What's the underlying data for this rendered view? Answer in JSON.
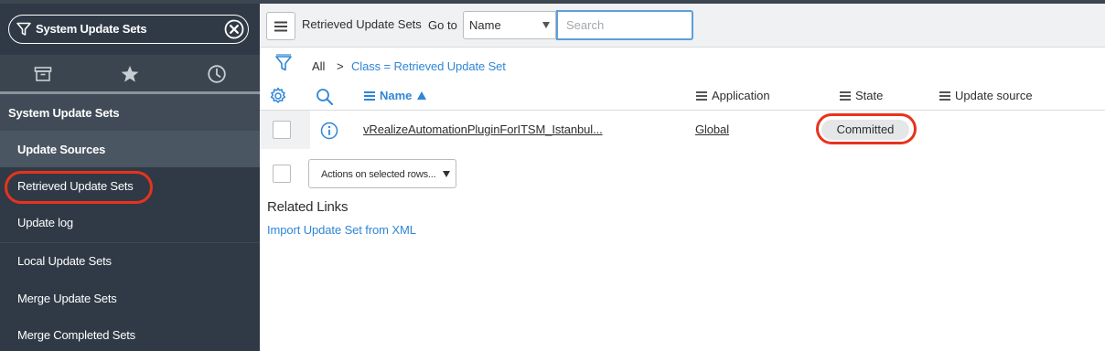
{
  "nav": {
    "filter_text": "System Update Sets",
    "tabs": [
      {
        "icon": "archive-icon"
      },
      {
        "icon": "star-icon"
      },
      {
        "icon": "clock-icon"
      }
    ],
    "section_label": "System Update Sets",
    "items": [
      {
        "label": "Update Sources"
      },
      {
        "label": "Retrieved Update Sets"
      },
      {
        "label": "Update log"
      },
      {
        "label": "Local Update Sets"
      },
      {
        "label": "Merge Update Sets"
      },
      {
        "label": "Merge Completed Sets"
      }
    ]
  },
  "toolbar": {
    "title": "Retrieved Update Sets",
    "goto_label": "Go to",
    "goto_field": "Name",
    "search_placeholder": "Search"
  },
  "breadcrumb": {
    "all": "All",
    "separator": ">",
    "condition": "Class = Retrieved Update Set"
  },
  "table": {
    "columns": [
      "Name",
      "Application",
      "State",
      "Update source"
    ],
    "sorted_column": "Name",
    "rows": [
      {
        "name": "vRealizeAutomationPluginForITSM_Istanbul...",
        "application": "Global",
        "state": "Committed",
        "update_source": ""
      }
    ]
  },
  "actions_label": "Actions on selected rows...",
  "related": {
    "title": "Related Links",
    "link": "Import Update Set from XML"
  },
  "colors": {
    "nav_bg": "#303a46",
    "link_blue": "#2f86d6",
    "highlight_red": "#e8331c"
  }
}
